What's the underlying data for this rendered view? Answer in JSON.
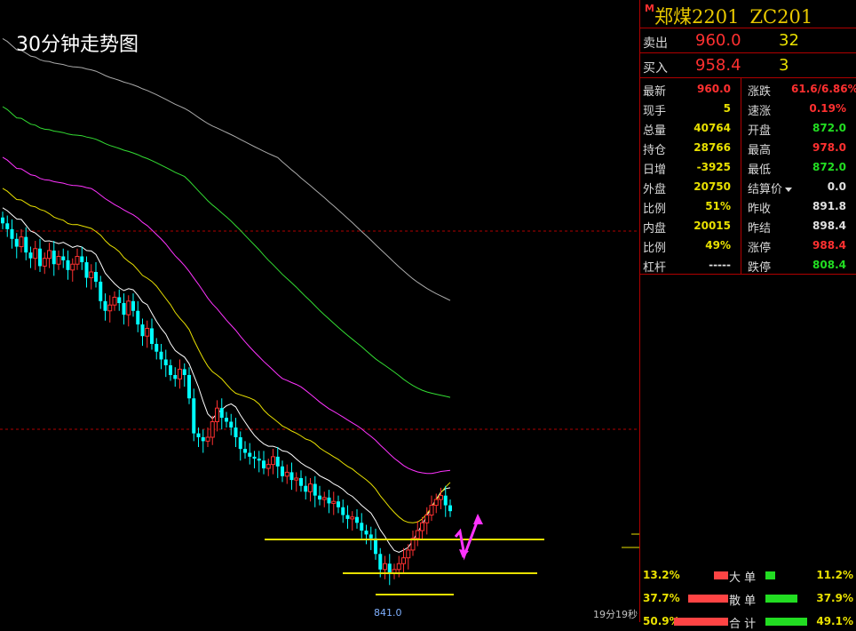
{
  "chart": {
    "title": "30分钟走势图",
    "low_label": "841.0",
    "timer": "19分19秒"
  },
  "instrument": {
    "badge": "M",
    "name": "郑煤2201",
    "code": "ZC201"
  },
  "orderbook": {
    "ask_label": "卖出",
    "ask_price": "960.0",
    "ask_volume": "32",
    "bid_label": "买入",
    "bid_price": "958.4",
    "bid_volume": "3"
  },
  "quote": {
    "rows": [
      {
        "l": "最新",
        "lv": "960.0",
        "lc": "#ff3030",
        "r": "涨跌",
        "rv": "61.6/6.86%",
        "rc": "#ff3030"
      },
      {
        "l": "现手",
        "lv": "5",
        "lc": "#e8e000",
        "r": "速涨",
        "rv": "0.19%",
        "rc": "#ff3030"
      },
      {
        "l": "总量",
        "lv": "40764",
        "lc": "#e8e000",
        "r": "开盘",
        "rv": "872.0",
        "rc": "#22dd22"
      },
      {
        "l": "持仓",
        "lv": "28766",
        "lc": "#e8e000",
        "r": "最高",
        "rv": "978.0",
        "rc": "#ff3030"
      },
      {
        "l": "日增",
        "lv": "-3925",
        "lc": "#e8e000",
        "r": "最低",
        "rv": "872.0",
        "rc": "#22dd22"
      },
      {
        "l": "外盘",
        "lv": "20750",
        "lc": "#e8e000",
        "r": "结算价",
        "rv": "0.0",
        "rc": "#e0e0e0"
      },
      {
        "l": "比例",
        "lv": "51%",
        "lc": "#e8e000",
        "r": "昨收",
        "rv": "891.8",
        "rc": "#e0e0e0"
      },
      {
        "l": "内盘",
        "lv": "20015",
        "lc": "#e8e000",
        "r": "昨结",
        "rv": "898.4",
        "rc": "#e0e0e0"
      },
      {
        "l": "比例",
        "lv": "49%",
        "lc": "#e8e000",
        "r": "涨停",
        "rv": "988.4",
        "rc": "#ff3030"
      },
      {
        "l": "杠杆",
        "lv": "-----",
        "lc": "#e0e0e0",
        "r": "跌停",
        "rv": "808.4",
        "rc": "#22dd22"
      }
    ]
  },
  "flows": [
    {
      "left_pct": "13.2%",
      "label": "大 单",
      "right_pct": "11.2%",
      "buy": 0.132,
      "sell": 0.112
    },
    {
      "left_pct": "37.7%",
      "label": "散 单",
      "right_pct": "37.9%",
      "buy": 0.377,
      "sell": 0.379
    },
    {
      "left_pct": "50.9%",
      "label": "合 计",
      "right_pct": "49.1%",
      "buy": 0.509,
      "sell": 0.491
    }
  ],
  "colors": {
    "up": "#ff3030",
    "down": "#00ffff",
    "accent": "#e8e000",
    "green": "#22dd22",
    "grid": "#b00000"
  },
  "chart_data": {
    "type": "candlestick",
    "title": "30分钟走势图",
    "low": 841.0,
    "ylim": [
      835,
      1090
    ],
    "closes": [
      1030,
      1027,
      1022,
      1018,
      1023,
      1015,
      1012,
      1017,
      1008,
      1012,
      1016,
      1009,
      1013,
      1011,
      1006,
      1009,
      1013,
      1010,
      1002,
      1005,
      1000,
      990,
      985,
      988,
      992,
      989,
      983,
      990,
      985,
      978,
      972,
      976,
      968,
      964,
      960,
      957,
      952,
      950,
      955,
      952,
      940,
      922,
      920,
      918,
      920,
      928,
      935,
      930,
      928,
      925,
      920,
      914,
      912,
      910,
      909,
      908,
      904,
      906,
      910,
      905,
      900,
      902,
      898,
      899,
      895,
      892,
      896,
      890,
      888,
      889,
      886,
      887,
      884,
      880,
      878,
      879,
      876,
      872,
      870,
      868,
      860,
      852,
      855,
      850,
      852,
      855,
      858,
      862,
      868,
      872,
      876,
      880,
      885,
      888,
      890,
      885,
      882
    ]
  }
}
